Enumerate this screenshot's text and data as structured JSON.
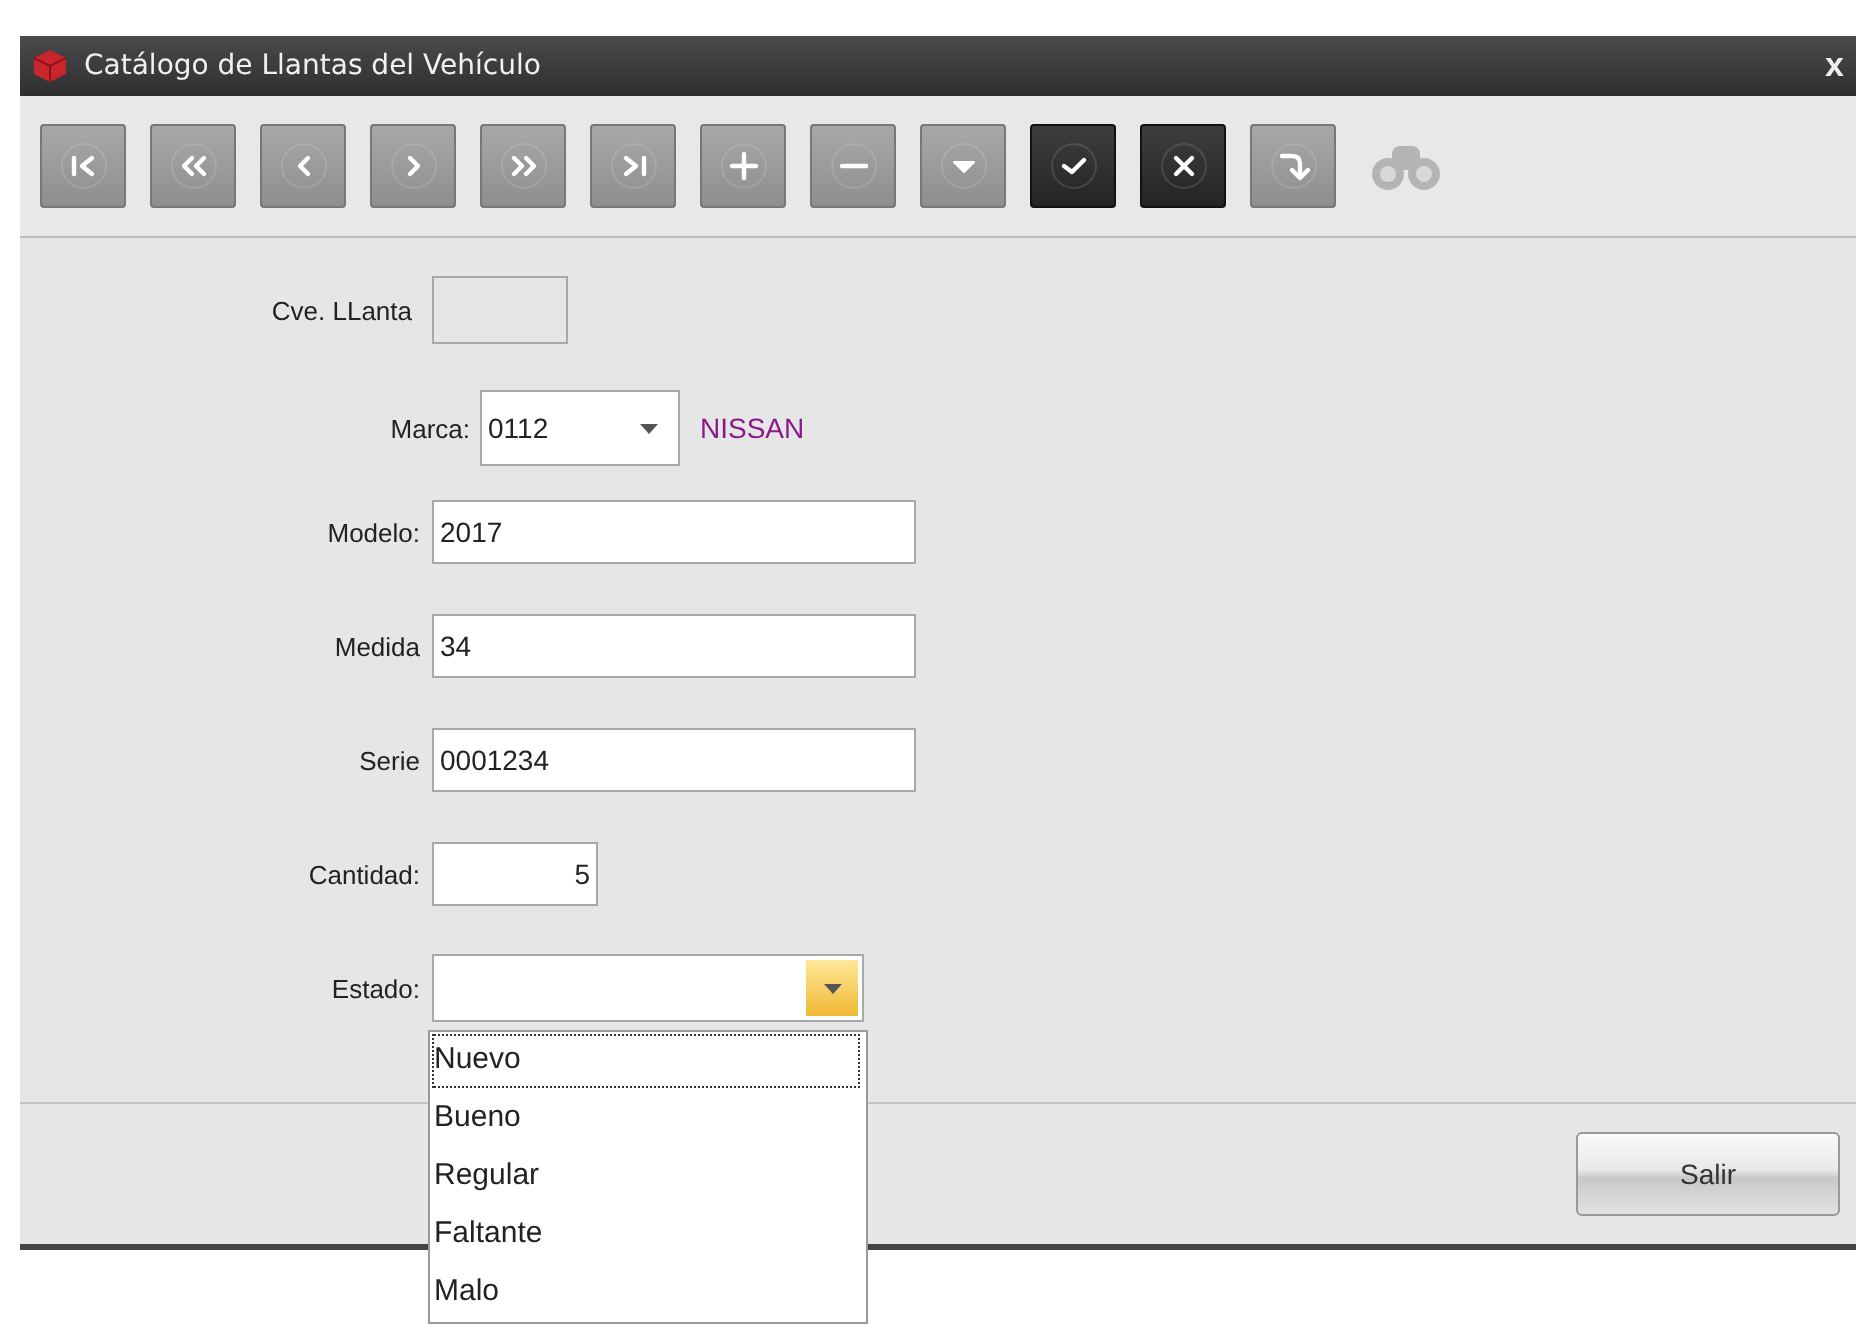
{
  "window": {
    "title": "Catálogo de Llantas del Vehículo",
    "close": "x"
  },
  "toolbar": [
    {
      "kind": "first",
      "enabled": false
    },
    {
      "kind": "prev-page",
      "enabled": false
    },
    {
      "kind": "prev",
      "enabled": false
    },
    {
      "kind": "next",
      "enabled": false
    },
    {
      "kind": "next-page",
      "enabled": false
    },
    {
      "kind": "last",
      "enabled": false
    },
    {
      "kind": "add",
      "enabled": false
    },
    {
      "kind": "remove",
      "enabled": false
    },
    {
      "kind": "dropdown",
      "enabled": false
    },
    {
      "kind": "confirm",
      "enabled": true
    },
    {
      "kind": "cancel",
      "enabled": true
    },
    {
      "kind": "redo",
      "enabled": false
    },
    {
      "kind": "search",
      "enabled": false
    }
  ],
  "form": [
    {
      "kind": "short",
      "label": "Cve. LLanta"
    },
    {
      "kind": "combo",
      "label": "Marca:",
      "value": "0112",
      "note": "NISSAN"
    },
    {
      "kind": "text",
      "label": "Modelo:",
      "value": "2017"
    },
    {
      "kind": "text",
      "label": "Medida",
      "value": "34"
    },
    {
      "kind": "text",
      "label": "Serie",
      "value": "0001234"
    },
    {
      "kind": "number",
      "label": "Cantidad:",
      "value": "5"
    },
    {
      "kind": "select",
      "label": "Estado:",
      "open": true
    }
  ],
  "estado_options": [
    {
      "label": "Nuevo",
      "selected": true
    },
    {
      "label": "Bueno",
      "selected": false
    },
    {
      "label": "Regular",
      "selected": false
    },
    {
      "label": "Faltante",
      "selected": false
    },
    {
      "label": "Malo",
      "selected": false
    }
  ],
  "buttons": [
    "Salir"
  ]
}
